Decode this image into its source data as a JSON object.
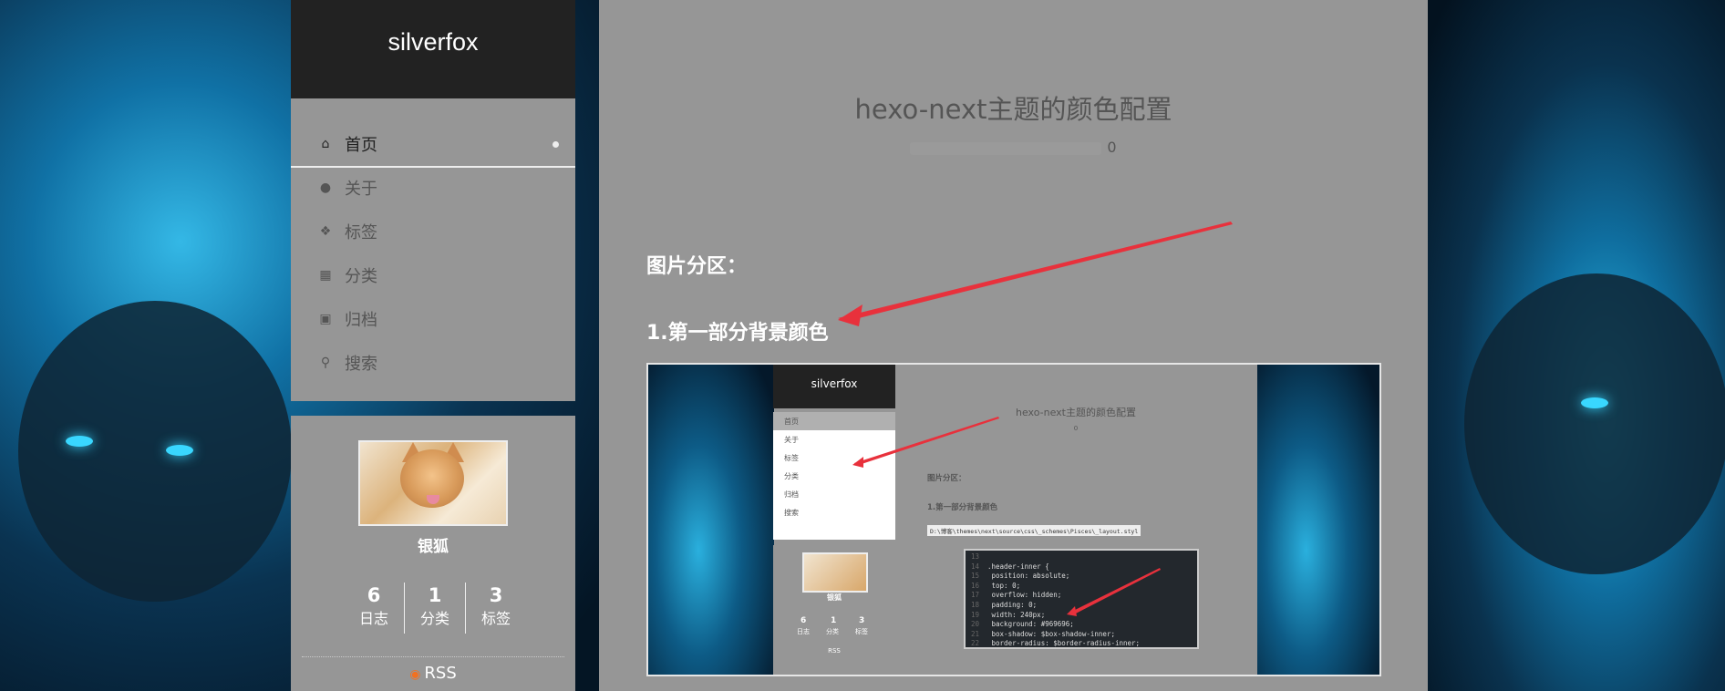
{
  "site": {
    "title": "silverfox"
  },
  "menu": {
    "items": [
      {
        "label": "首页",
        "icon": "home-icon",
        "active": true
      },
      {
        "label": "关于",
        "icon": "user-icon"
      },
      {
        "label": "标签",
        "icon": "tags-icon"
      },
      {
        "label": "分类",
        "icon": "grid-icon"
      },
      {
        "label": "归档",
        "icon": "archive-icon"
      },
      {
        "label": "搜索",
        "icon": "search-icon"
      }
    ]
  },
  "profile": {
    "author": "银狐",
    "stats": [
      {
        "num": "6",
        "label": "日志"
      },
      {
        "num": "1",
        "label": "分类"
      },
      {
        "num": "3",
        "label": "标签"
      }
    ],
    "rss": "RSS"
  },
  "post": {
    "title": "hexo-next主题的颜色配置",
    "meta_count": "0",
    "section_heading": "图片分区：",
    "sub_heading": "1.第一部分背景颜色"
  },
  "screenshot": {
    "site_title": "silverfox",
    "menu": [
      "首页",
      "关于",
      "标签",
      "分类",
      "归档",
      "搜索"
    ],
    "author": "银狐",
    "stats": [
      {
        "num": "6",
        "label": "日志"
      },
      {
        "num": "1",
        "label": "分类"
      },
      {
        "num": "3",
        "label": "标签"
      }
    ],
    "rss": "RSS",
    "post_title": "hexo-next主题的颜色配置",
    "meta_count": "0",
    "section_heading": "图片分区：",
    "sub_heading": "1.第一部分背景颜色",
    "path": "D:\\博客\\themes\\next\\source\\css\\_schemes\\Pisces\\_layout.styl",
    "code": [
      {
        "ln": "13",
        "text": ""
      },
      {
        "ln": "14",
        "text": ".header-inner {"
      },
      {
        "ln": "15",
        "text": "  position: absolute;"
      },
      {
        "ln": "16",
        "text": "  top: 0;"
      },
      {
        "ln": "17",
        "text": "  overflow: hidden;"
      },
      {
        "ln": "18",
        "text": "  padding: 0;"
      },
      {
        "ln": "19",
        "text": "  width: 240px;"
      },
      {
        "ln": "20",
        "text": "  background: #969696;"
      },
      {
        "ln": "21",
        "text": "  box-shadow: $box-shadow-inner;"
      },
      {
        "ln": "22",
        "text": "  border-radius: $border-radius-inner;"
      }
    ]
  },
  "colors": {
    "header_bg": "#222222",
    "panel_bg": "#969696",
    "arrow": "#e8313c",
    "rss": "#f27121"
  }
}
